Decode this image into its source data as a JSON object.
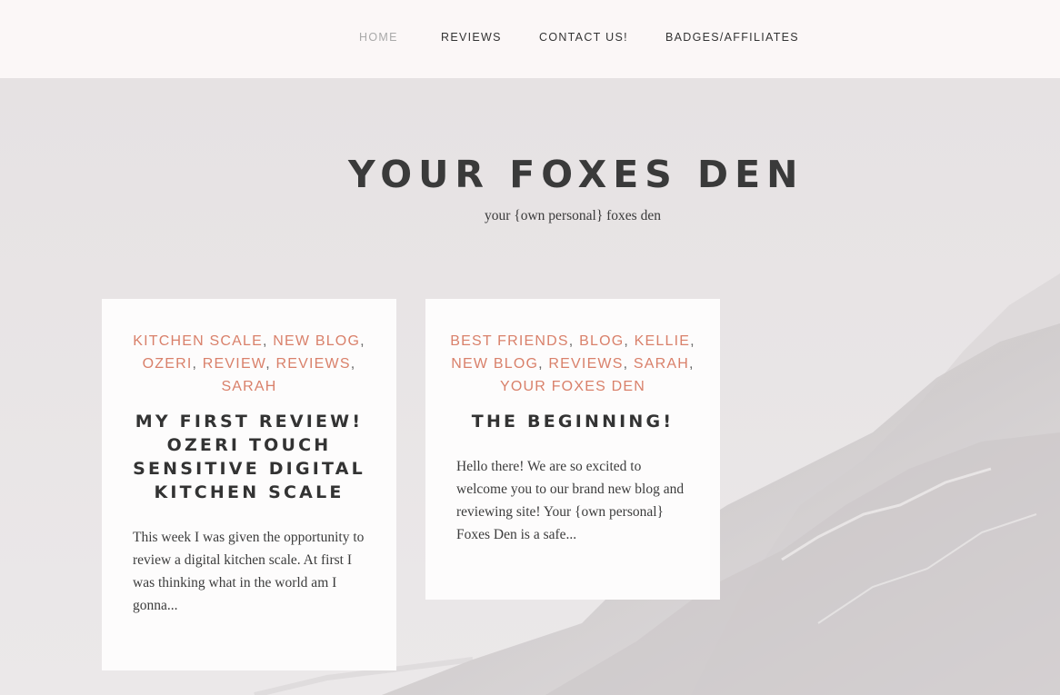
{
  "nav": {
    "items": [
      {
        "label": "HOME",
        "active": true
      },
      {
        "label": "REVIEWS",
        "active": false
      },
      {
        "label": "CONTACT US!",
        "active": false
      },
      {
        "label": "BADGES/AFFILIATES",
        "active": false
      }
    ]
  },
  "site": {
    "title": "YOUR FOXES DEN",
    "tagline": "your {own personal} foxes den"
  },
  "posts": [
    {
      "tags": [
        "KITCHEN SCALE",
        "NEW BLOG",
        "OZERI",
        "REVIEW",
        "REVIEWS",
        "SARAH"
      ],
      "title": "MY FIRST REVIEW! OZERI TOUCH SENSITIVE DIGITAL KITCHEN SCALE",
      "excerpt": "This week I was given the opportunity to review a digital kitchen scale. At first I was thinking what in the world am I gonna..."
    },
    {
      "tags": [
        "BEST FRIENDS",
        "BLOG",
        "KELLIE",
        "NEW BLOG",
        "REVIEWS",
        "SARAH",
        "YOUR FOXES DEN"
      ],
      "title": "THE BEGINNING!",
      "excerpt": "Hello there! We are so excited to welcome you to our brand new blog and reviewing site! Your {own personal} Foxes Den is a safe..."
    }
  ],
  "colors": {
    "header_bg": "#fbf7f7",
    "page_bg": "#e8e4e5",
    "accent_tag": "#d9806a",
    "text_dark": "#333333",
    "nav_active": "#a9a9a9"
  }
}
